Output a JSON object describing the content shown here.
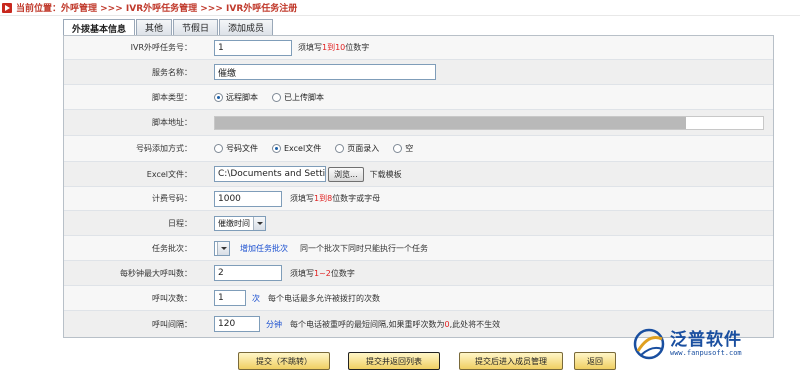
{
  "breadcrumb": {
    "text": "当前位置：外呼管理 >>> IVR外呼任务管理 >>> IVR外呼任务注册"
  },
  "tabs": [
    {
      "label": "外拨基本信息",
      "active": true
    },
    {
      "label": "其他",
      "active": false
    },
    {
      "label": "节假日",
      "active": false
    },
    {
      "label": "添加成员",
      "active": false
    }
  ],
  "form": {
    "task_no": {
      "label": "IVR外呼任务号：",
      "value": "1",
      "hint_pre": "须填写",
      "hint_red": "1到10",
      "hint_post": "位数字"
    },
    "service_name": {
      "label": "服务名称：",
      "value": "催缴"
    },
    "script_type": {
      "label": "脚本类型：",
      "options": [
        "远程脚本",
        "已上传脚本"
      ],
      "selected": "远程脚本"
    },
    "script_url": {
      "label": "脚本地址：",
      "fill_fraction": 0.86
    },
    "number_method": {
      "label": "号码添加方式：",
      "options": [
        "号码文件",
        "Excel文件",
        "页面录入",
        "空"
      ],
      "selected": "Excel文件"
    },
    "excel_file": {
      "label": "Excel文件：",
      "value": "C:\\Documents and Setting",
      "browse": "浏览...",
      "download": "下载模板"
    },
    "billing_no": {
      "label": "计费号码：",
      "value": "1000",
      "hint_pre": "须填写",
      "hint_red": "1到8",
      "hint_post": "位数字或字母"
    },
    "schedule": {
      "label": "日程：",
      "value": "催缴时间"
    },
    "batch": {
      "label": "任务批次：",
      "link": "增加任务批次",
      "hint": "同一个批次下同时只能执行一个任务"
    },
    "max_calls": {
      "label": "每秒钟最大呼叫数：",
      "value": "2",
      "hint_pre": "须填写",
      "hint_red": "1~2",
      "hint_post": "位数字"
    },
    "call_count": {
      "label": "呼叫次数：",
      "value": "1",
      "unit": "次",
      "hint": "每个电话最多允许被拨打的次数"
    },
    "call_interval": {
      "label": "呼叫间隔：",
      "value": "120",
      "unit": "分钟",
      "hint_pre": "每个电话被重呼的最短间隔,如果重呼次数为",
      "hint_red": "0",
      "hint_post": ",此处将不生效"
    }
  },
  "buttons": {
    "submit_stay": "提交（不跳转）",
    "submit_return": "提交并返回列表",
    "submit_members": "提交后进入成员管理",
    "back": "返回"
  },
  "logo": {
    "name": "泛普软件",
    "url": "www.fanpusoft.com"
  },
  "colors": {
    "accent_red": "#c0392b",
    "link_blue": "#1a4fd0",
    "button_gold": "#f0cf62",
    "logo_blue": "#1a4fa0"
  }
}
